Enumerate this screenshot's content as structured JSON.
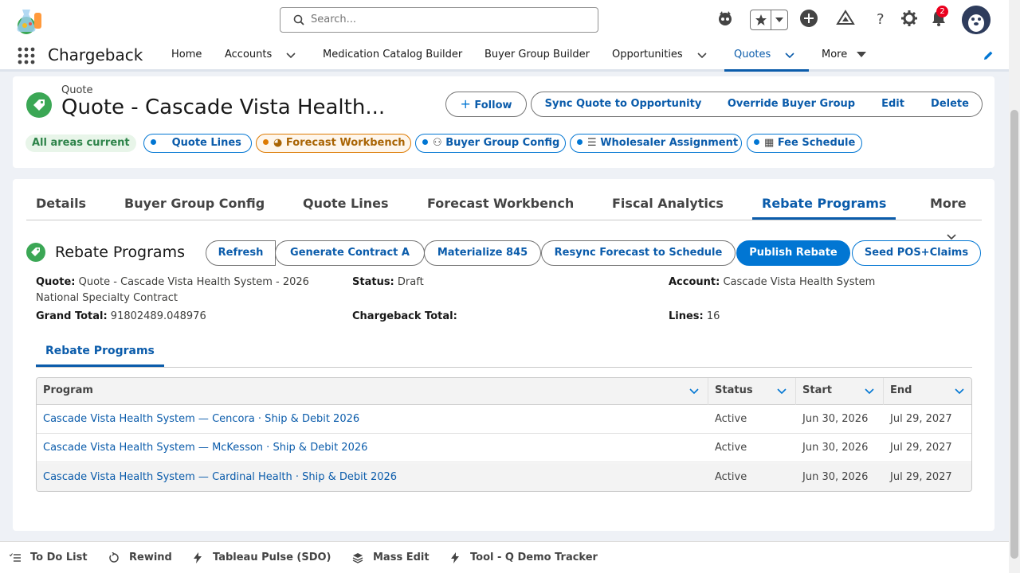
{
  "global": {
    "search_placeholder": "Search...",
    "notifications_count": "2"
  },
  "nav": {
    "app_name": "Chargeback",
    "items": [
      "Home",
      "Accounts",
      "Medication Catalog Builder",
      "Buyer Group Builder",
      "Opportunities",
      "Quotes",
      "More"
    ],
    "active": "Quotes"
  },
  "record": {
    "type": "Quote",
    "title": "Quote - Cascade Vista Health...",
    "actions": {
      "follow": "Follow",
      "sync": "Sync Quote to Opportunity",
      "override": "Override Buyer Group",
      "edit": "Edit",
      "delete": "Delete"
    }
  },
  "path": {
    "status": "All areas current",
    "chips": [
      "Quote Lines",
      "Forecast Workbench",
      "Buyer Group Config",
      "Wholesaler Assignment",
      "Fee Schedule"
    ]
  },
  "tabs": [
    "Details",
    "Buyer Group Config",
    "Quote Lines",
    "Forecast Workbench",
    "Fiscal Analytics",
    "Rebate Programs",
    "More"
  ],
  "active_tab": "Rebate Programs",
  "section": {
    "title": "Rebate Programs",
    "buttons": [
      "Refresh",
      "Generate Contract A",
      "Materialize 845",
      "Resync Forecast to Schedule",
      "Publish Rebate",
      "Seed POS+Claims"
    ],
    "fields": {
      "quote_label": "Quote:",
      "quote_value": "Quote - Cascade Vista Health System - 2026 National Specialty Contract",
      "status_label": "Status:",
      "status_value": "Draft",
      "account_label": "Account:",
      "account_value": "Cascade Vista Health System",
      "grand_total_label": "Grand Total:",
      "grand_total_value": "91802489.048976",
      "chargeback_total_label": "Chargeback Total:",
      "chargeback_total_value": "",
      "lines_label": "Lines:",
      "lines_value": "16"
    }
  },
  "subtab": "Rebate Programs",
  "table": {
    "columns": [
      "Program",
      "Status",
      "Start",
      "End"
    ],
    "rows": [
      {
        "program": "Cascade Vista Health System — Cencora · Ship & Debit 2026",
        "status": "Active",
        "start": "Jun 30, 2026",
        "end": "Jul 29, 2027"
      },
      {
        "program": "Cascade Vista Health System — McKesson · Ship & Debit 2026",
        "status": "Active",
        "start": "Jun 30, 2026",
        "end": "Jul 29, 2027"
      },
      {
        "program": "Cascade Vista Health System — Cardinal Health · Ship & Debit 2026",
        "status": "Active",
        "start": "Jun 30, 2026",
        "end": "Jul 29, 2027"
      }
    ]
  },
  "utility_bar": [
    "To Do List",
    "Rewind",
    "Tableau Pulse (SDO)",
    "Mass Edit",
    "Tool - Q Demo Tracker"
  ]
}
